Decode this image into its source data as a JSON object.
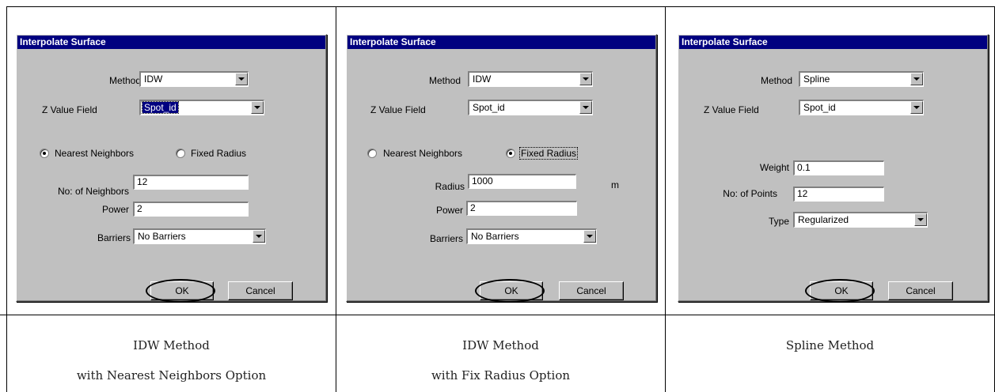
{
  "panels": [
    {
      "title": "Interpolate Surface",
      "method_label": "Method",
      "method_value": "IDW",
      "zfield_label": "Z Value Field",
      "zfield_value": "Spot_id",
      "radio1_label": "Nearest Neighbors",
      "radio2_label": "Fixed Radius",
      "neighbors_label": "No: of Neighbors",
      "neighbors_value": "12",
      "power_label": "Power",
      "power_value": "2",
      "barriers_label": "Barriers",
      "barriers_value": "No Barriers",
      "ok": "OK",
      "cancel": "Cancel"
    },
    {
      "title": "Interpolate Surface",
      "method_label": "Method",
      "method_value": "IDW",
      "zfield_label": "Z Value Field",
      "zfield_value": "Spot_id",
      "radio1_label": "Nearest Neighbors",
      "radio2_label": "Fixed Radius",
      "radius_label": "Radius",
      "radius_value": "1000",
      "radius_unit": "m",
      "power_label": "Power",
      "power_value": "2",
      "barriers_label": "Barriers",
      "barriers_value": "No Barriers",
      "ok": "OK",
      "cancel": "Cancel"
    },
    {
      "title": "Interpolate Surface",
      "method_label": "Method",
      "method_value": "Spline",
      "zfield_label": "Z Value Field",
      "zfield_value": "Spot_id",
      "weight_label": "Weight",
      "weight_value": "0.1",
      "points_label": "No: of Points",
      "points_value": "12",
      "type_label": "Type",
      "type_value": "Regularized",
      "ok": "OK",
      "cancel": "Cancel"
    }
  ],
  "captions": [
    {
      "line1": "IDW Method",
      "line2": "with Nearest Neighbors Option"
    },
    {
      "line1": "IDW Method",
      "line2": "with Fix Radius Option"
    },
    {
      "line1": "Spline Method",
      "line2": ""
    }
  ]
}
